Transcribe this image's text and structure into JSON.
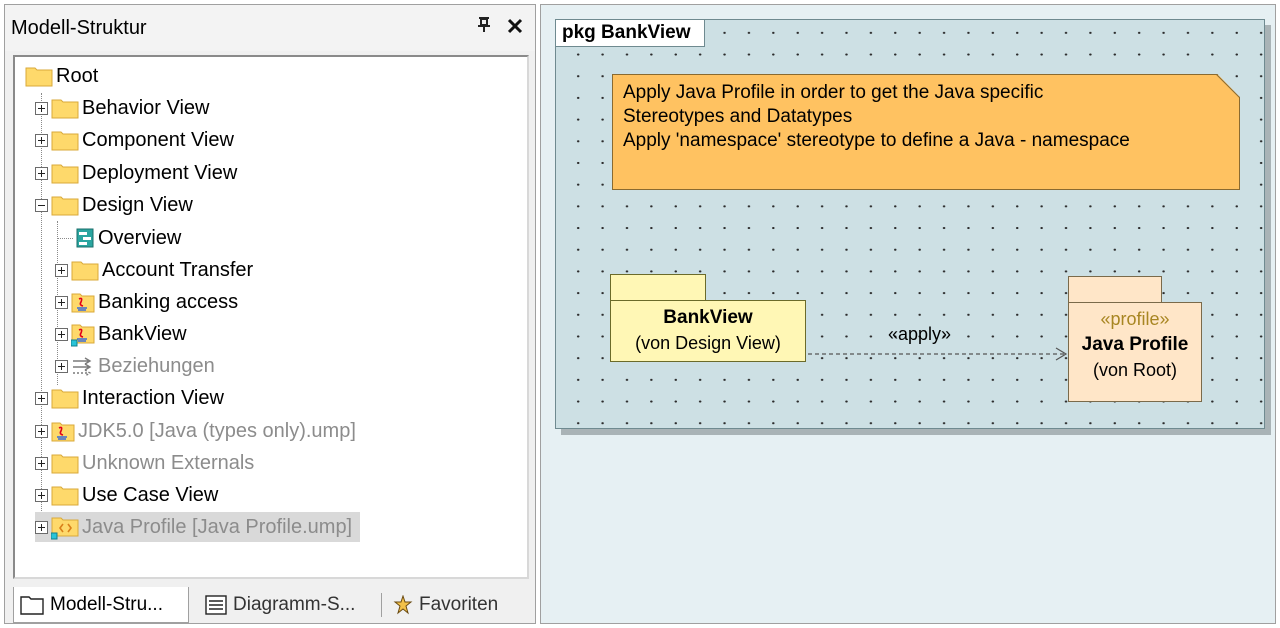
{
  "panel": {
    "title": "Modell-Struktur",
    "pin_label": "Q",
    "close_label": "✕"
  },
  "tree": {
    "root": "Root",
    "items": [
      {
        "label": "Behavior View"
      },
      {
        "label": "Component View"
      },
      {
        "label": "Deployment View"
      },
      {
        "label": "Design View"
      },
      {
        "label": "Overview"
      },
      {
        "label": "Account Transfer"
      },
      {
        "label": "Banking access"
      },
      {
        "label": "BankView"
      },
      {
        "label": "Beziehungen"
      },
      {
        "label": "Interaction View"
      },
      {
        "label": "JDK5.0 [Java (types only).ump]"
      },
      {
        "label": "Unknown Externals"
      },
      {
        "label": "Use Case View"
      },
      {
        "label": "Java Profile [Java Profile.ump]"
      }
    ]
  },
  "tabs": [
    {
      "label": "Modell-Stru..."
    },
    {
      "label": "Diagramm-S..."
    },
    {
      "label": "Favoriten"
    }
  ],
  "diagram": {
    "frame_label": "pkg BankView",
    "note_lines": [
      "Apply Java Profile in order to get the Java specific",
      "Stereotypes and Datatypes",
      "Apply 'namespace' stereotype to define a Java - namespace"
    ],
    "bankview": {
      "name": "BankView",
      "owner": "(von Design View)"
    },
    "dependency_stereotype": "«apply»",
    "profile": {
      "stereotype": "«profile»",
      "name": "Java Profile",
      "owner": "(von Root)"
    }
  },
  "colors": {
    "folder": "#fed96b",
    "note": "#ffc261",
    "package_fill": "#fff7b5",
    "profile_fill": "#ffe6c8",
    "frame": "#cde0e4"
  }
}
